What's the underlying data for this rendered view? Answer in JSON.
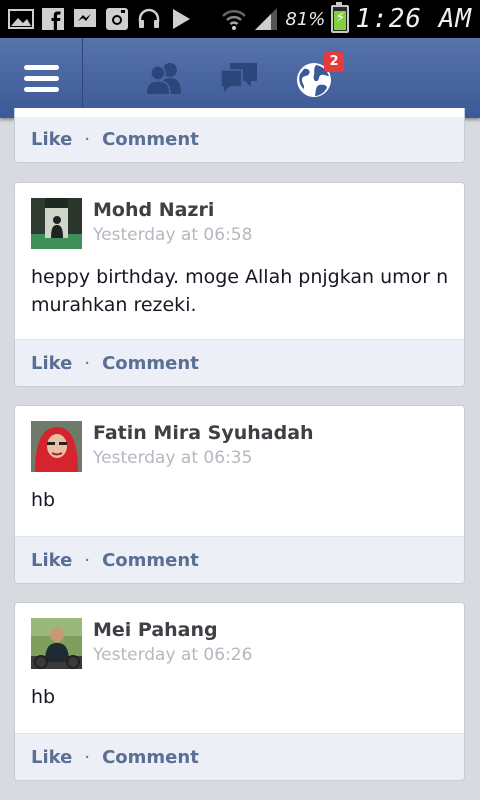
{
  "status_bar": {
    "battery_percent": "81%",
    "time": "1:26 AM",
    "icons": [
      "gallery-icon",
      "facebook-icon",
      "messenger-icon",
      "instagram-icon",
      "headphones-icon",
      "play-store-icon",
      "wifi-icon",
      "signal-icon",
      "battery-charging-icon"
    ]
  },
  "header": {
    "icons": [
      "menu-icon",
      "friend-requests-icon",
      "messages-icon",
      "notifications-globe-icon"
    ],
    "notification_count": "2",
    "brand_color": "#3b5998",
    "badge_color": "#e53b3b"
  },
  "top_card": {
    "like_label": "Like",
    "separator": "·",
    "comment_label": "Comment"
  },
  "comments": [
    {
      "name": "Mohd Nazri",
      "timestamp": "Yesterday at 06:58",
      "message": "heppy birthday. moge Allah pnjgkan umor n murahkan rezeki.",
      "like_label": "Like",
      "separator": "·",
      "comment_label": "Comment"
    },
    {
      "name": "Fatin Mira Syuhadah",
      "timestamp": "Yesterday at 06:35",
      "message": "hb",
      "like_label": "Like",
      "separator": "·",
      "comment_label": "Comment"
    },
    {
      "name": "Mei Pahang",
      "timestamp": "Yesterday at 06:26",
      "message": "hb",
      "like_label": "Like",
      "separator": "·",
      "comment_label": "Comment"
    }
  ]
}
